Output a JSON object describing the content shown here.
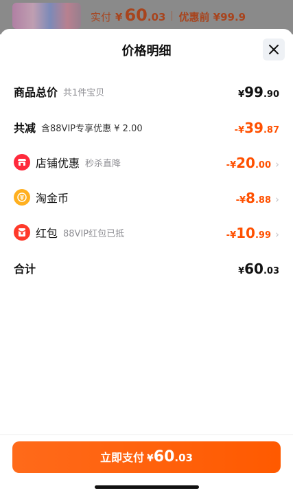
{
  "banner": {
    "paid_label": "实付",
    "paid_symbol": "¥",
    "paid_int": "60",
    "paid_dec": ".03",
    "before_label": "优惠前 ¥99.9"
  },
  "sheet": {
    "title": "价格明细"
  },
  "rows": {
    "subtotal": {
      "label": "商品总价",
      "sub": "共1件宝贝",
      "sym": "¥",
      "int": "99",
      "dec": ".90"
    },
    "total_discount": {
      "label": "共减",
      "sub": "含88VIP专享优惠 ¥ 2.00",
      "sym": "-¥",
      "int": "39",
      "dec": ".87"
    },
    "shop_discount": {
      "label": "店铺优惠",
      "sub": "秒杀直降",
      "sym": "-¥",
      "int": "20",
      "dec": ".00",
      "icon": "shop-icon"
    },
    "taojinbi": {
      "label": "淘金币",
      "sym": "-¥",
      "int": "8",
      "dec": ".88",
      "icon": "coin-icon"
    },
    "red_packet": {
      "label": "红包",
      "sub": "88VIP红包已抵",
      "sym": "-¥",
      "int": "10",
      "dec": ".99",
      "icon": "red-packet-icon"
    },
    "total": {
      "label": "合计",
      "sym": "¥",
      "int": "60",
      "dec": ".03"
    }
  },
  "pay_button": {
    "label": "立即支付",
    "sym": "¥",
    "int": "60",
    "dec": ".03"
  },
  "colors": {
    "accent": "#ff5000",
    "discount": "#ff5000"
  }
}
